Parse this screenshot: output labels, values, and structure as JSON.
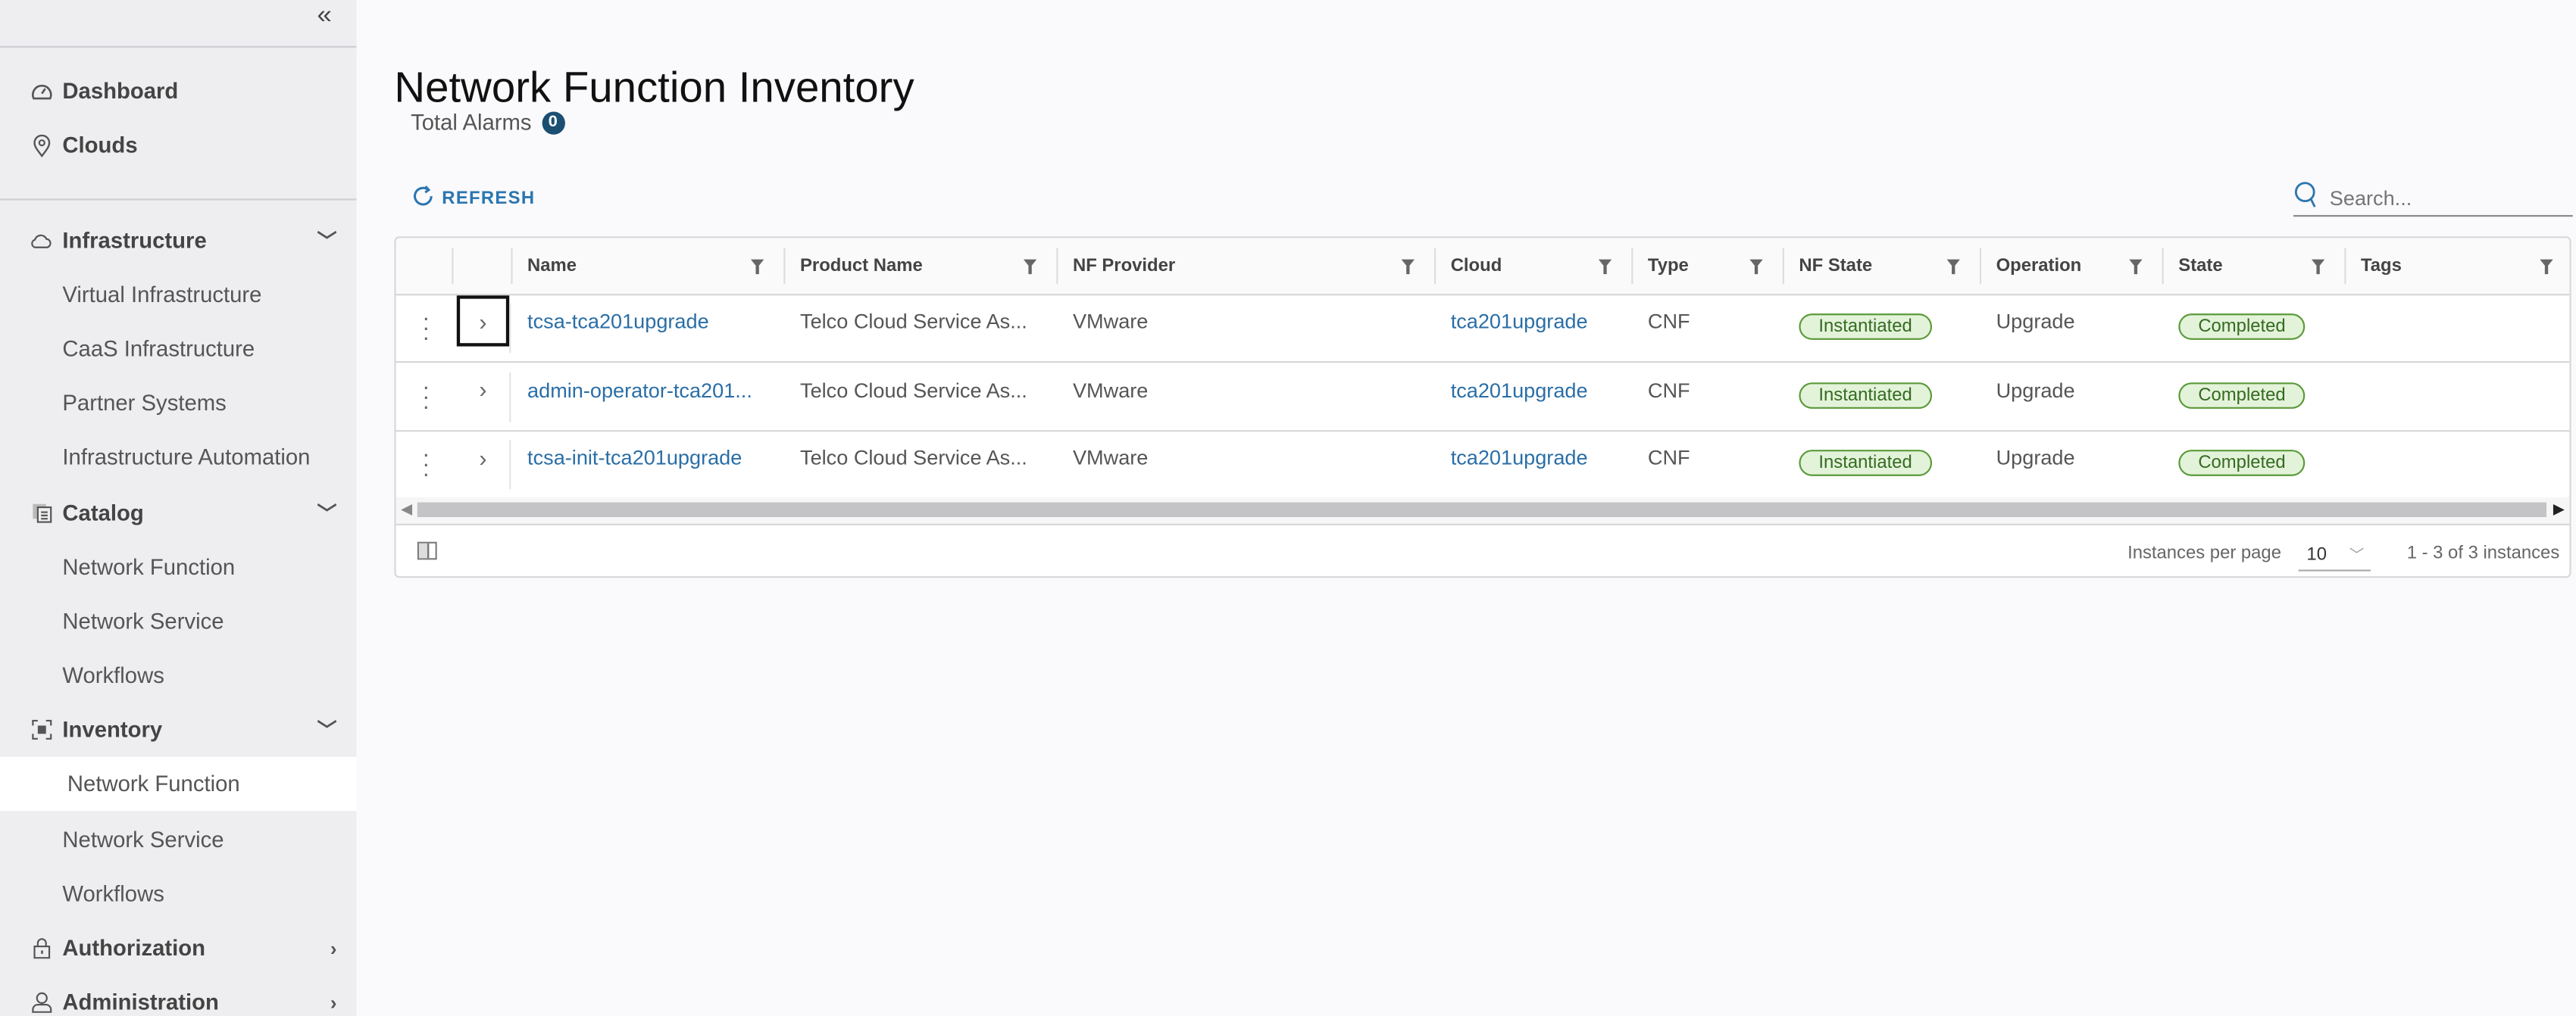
{
  "sidebar": {
    "top": [
      {
        "label": "Dashboard",
        "icon": "dashboard-icon"
      },
      {
        "label": "Clouds",
        "icon": "map-pin-icon"
      }
    ],
    "groups": [
      {
        "label": "Infrastructure",
        "icon": "cloud-icon",
        "expanded": true,
        "items": [
          "Virtual Infrastructure",
          "CaaS Infrastructure",
          "Partner Systems",
          "Infrastructure Automation"
        ]
      },
      {
        "label": "Catalog",
        "icon": "catalog-icon",
        "expanded": true,
        "items": [
          "Network Function",
          "Network Service",
          "Workflows"
        ]
      },
      {
        "label": "Inventory",
        "icon": "inventory-icon",
        "expanded": true,
        "items": [
          "Network Function",
          "Network Service",
          "Workflows"
        ],
        "active": "Network Function"
      },
      {
        "label": "Authorization",
        "icon": "lock-icon",
        "expanded": false
      },
      {
        "label": "Administration",
        "icon": "user-icon",
        "expanded": false
      }
    ]
  },
  "page": {
    "title": "Network Function Inventory",
    "alarms_label": "Total Alarms",
    "alarms_count": "0",
    "refresh_label": "REFRESH",
    "search_placeholder": "Search..."
  },
  "table": {
    "columns": [
      "Name",
      "Product Name",
      "NF Provider",
      "Cloud",
      "Type",
      "NF State",
      "Operation",
      "State",
      "Tags"
    ],
    "rows": [
      {
        "name": "tcsa-tca201upgrade",
        "product": "Telco Cloud Service As...",
        "provider": "VMware",
        "cloud": "tca201upgrade",
        "type": "CNF",
        "nf_state": "Instantiated",
        "operation": "Upgrade",
        "state": "Completed",
        "tags": ""
      },
      {
        "name": "admin-operator-tca201...",
        "product": "Telco Cloud Service As...",
        "provider": "VMware",
        "cloud": "tca201upgrade",
        "type": "CNF",
        "nf_state": "Instantiated",
        "operation": "Upgrade",
        "state": "Completed",
        "tags": ""
      },
      {
        "name": "tcsa-init-tca201upgrade",
        "product": "Telco Cloud Service As...",
        "provider": "VMware",
        "cloud": "tca201upgrade",
        "type": "CNF",
        "nf_state": "Instantiated",
        "operation": "Upgrade",
        "state": "Completed",
        "tags": ""
      }
    ],
    "footer": {
      "per_page_label": "Instances per page",
      "per_page_value": "10",
      "range_label": "1 - 3 of 3 instances"
    }
  },
  "colors": {
    "sidebar_bg": "#eeedf0",
    "link": "#2a6ea6",
    "badge": "#1b4f72",
    "pill_border": "#5a9a3a",
    "pill_bg": "#e3f3d9"
  }
}
